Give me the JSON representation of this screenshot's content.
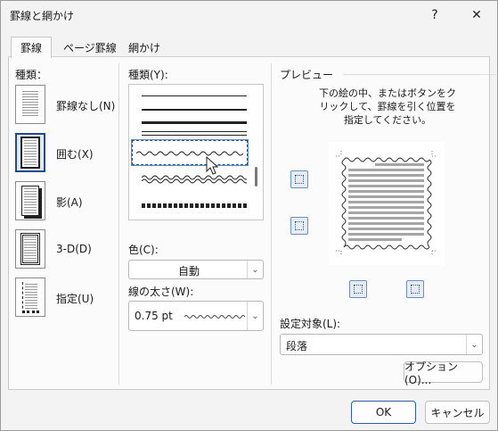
{
  "window": {
    "title": "罫線と網かけ",
    "help_glyph": "?",
    "close_glyph": "✕"
  },
  "tabs": [
    {
      "label": "罫線",
      "active": true
    },
    {
      "label": "ページ罫線",
      "active": false
    },
    {
      "label": "網かけ",
      "active": false
    }
  ],
  "setting": {
    "label": "種類：",
    "presets": [
      {
        "label": "罫線なし(N)",
        "icon": "no-border-icon",
        "selected": false
      },
      {
        "label": "囲む(X)",
        "icon": "box-border-icon",
        "selected": true
      },
      {
        "label": "影(A)",
        "icon": "shadow-border-icon",
        "selected": false
      },
      {
        "label": "3-D(D)",
        "icon": "3d-border-icon",
        "selected": false
      },
      {
        "label": "指定(U)",
        "icon": "custom-border-icon",
        "selected": false
      }
    ]
  },
  "style": {
    "label": "種類(Y):",
    "selected_index": 4
  },
  "color": {
    "label": "色(C):",
    "value": "自動"
  },
  "width": {
    "label": "線の太さ(W):",
    "value": "0.75 pt"
  },
  "preview": {
    "label": "プレビュー",
    "instructions": "下の絵の中、またはボタンをクリックして、罫線を引く位置を指定してください。"
  },
  "apply_to": {
    "label": "設定対象(L):",
    "value": "段落"
  },
  "buttons": {
    "options": "オプション(O)...",
    "ok": "OK",
    "cancel": "キャンセル"
  },
  "colors": {
    "accent": "#1f4e8c",
    "dialog_bg": "#f3f3f3",
    "panel_bg": "#fbfbfb"
  }
}
